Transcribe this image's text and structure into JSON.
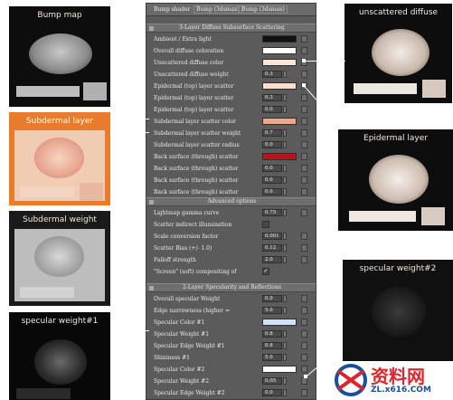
{
  "thumbs": {
    "bump": "Bump map",
    "subdermal_layer": "Subdermal layer",
    "subdermal_weight": "Subdermal weight",
    "specular_weight1": "specular weight#1",
    "unscattered": "unscattered diffuse",
    "epidermal": "Epidermal layer",
    "specular_weight2": "specular weight#2"
  },
  "topbar": {
    "label": "Bump shader",
    "btn1": "Bump (3dsmax)",
    "btn2": "Bump (3dsmax)"
  },
  "sections": {
    "s1": "3-Layer Diffuse Subsurface Scattering",
    "s2": "Advanced options",
    "s3": "2-Layer Specularity and Reflections"
  },
  "rows1": [
    {
      "label": "Ambient / Extra light",
      "type": "color",
      "color": "#111111"
    },
    {
      "label": "Overall diffuse coloration",
      "type": "color",
      "color": "#ffffff"
    },
    {
      "label": "Unscattered diffuse color",
      "type": "color",
      "color": "#fbe6d8"
    },
    {
      "label": "Unscattered diffuse weight",
      "type": "num",
      "value": "0.3"
    },
    {
      "label": "Epidermal (top) layer scatter",
      "type": "color",
      "color": "#fae0cc"
    },
    {
      "label": "Epidermal (top) layer scatter",
      "type": "num",
      "value": "0.3"
    },
    {
      "label": "Epidermal (top) layer scatter",
      "type": "num",
      "value": "0.0"
    },
    {
      "label": "Subdermal layer scatter color",
      "type": "color",
      "color": "#f2a48a"
    },
    {
      "label": "Subdermal layer scatter weight",
      "type": "num",
      "value": "0.7"
    },
    {
      "label": "Subdermal layer scatter radius",
      "type": "num",
      "value": "0.0"
    },
    {
      "label": "Back surface (through) scatter",
      "type": "color",
      "color": "#b51616"
    },
    {
      "label": "Back surface (through) scatter",
      "type": "num",
      "value": "0.0"
    },
    {
      "label": "Back surface (through) scatter",
      "type": "num",
      "value": "0.0"
    },
    {
      "label": "Back surface (through) scatter",
      "type": "num",
      "value": "0.0"
    }
  ],
  "rows2": [
    {
      "label": "Lightmap gamma curve",
      "type": "num",
      "value": "0.75"
    },
    {
      "label": "Scatter indirect illumination",
      "type": "check",
      "value": ""
    },
    {
      "label": "Scale conversion factor",
      "type": "num",
      "value": "0.001"
    },
    {
      "label": "Scatter Bias (+/- 1.0)",
      "type": "num",
      "value": "0.12"
    },
    {
      "label": "Falloff strength",
      "type": "num",
      "value": "2.0"
    },
    {
      "label": "\"Screen\" (soft) compositing of",
      "type": "check",
      "value": "✓"
    }
  ],
  "rows3": [
    {
      "label": "Overall specular Weight",
      "type": "num",
      "value": "0.9"
    },
    {
      "label": "Edge narrowness (higher =",
      "type": "num",
      "value": "5.0"
    },
    {
      "label": "Specular Color #1",
      "type": "color",
      "color": "#cfe2f7"
    },
    {
      "label": "Specular Weight #1",
      "type": "num",
      "value": "0.8"
    },
    {
      "label": "Specular Edge Weight #1",
      "type": "num",
      "value": "0.8"
    },
    {
      "label": "Shininess #1",
      "type": "num",
      "value": "5.0"
    },
    {
      "label": "Specular Color #2",
      "type": "color",
      "color": "#ffffff"
    },
    {
      "label": "Specular Weight #2",
      "type": "num",
      "value": "0.05"
    },
    {
      "label": "Specular Edge Weight #2",
      "type": "num",
      "value": "0.0"
    }
  ],
  "watermark": {
    "big": "资料网",
    "url": "ZL.x616.COM"
  }
}
